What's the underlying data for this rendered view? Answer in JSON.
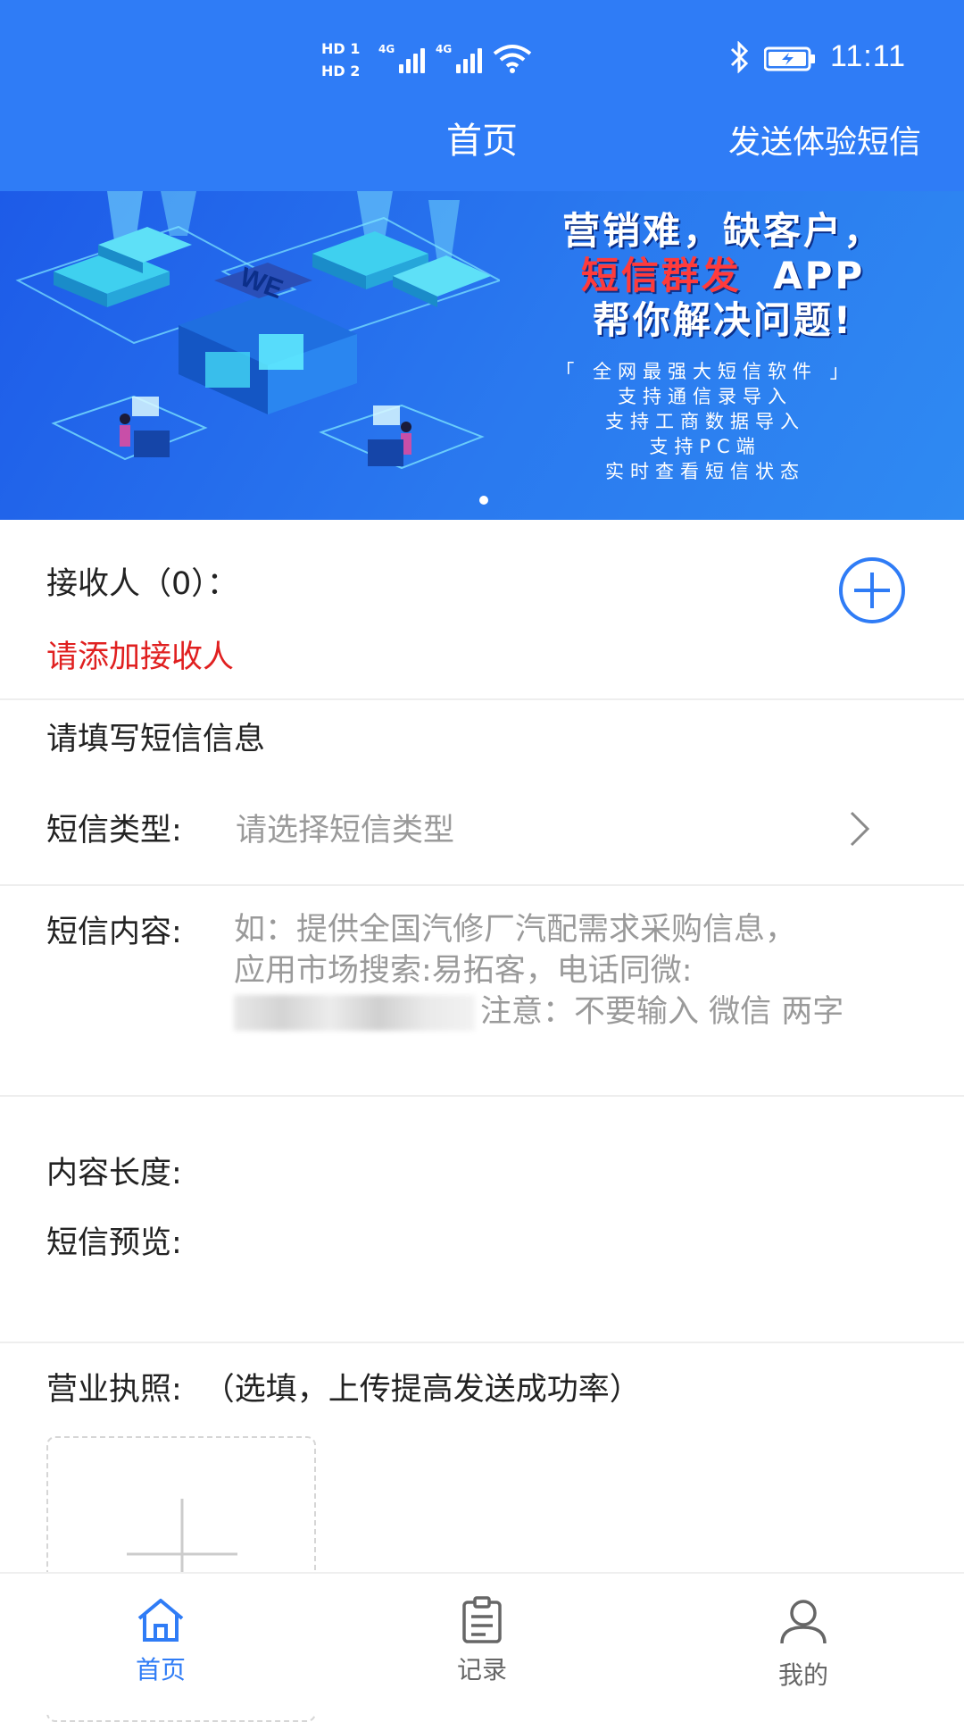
{
  "status_bar": {
    "hd1": "HD 1",
    "hd2": "HD 2",
    "network1": "4G",
    "network2": "4G",
    "time": "11:11"
  },
  "header": {
    "title": "首页",
    "action": "发送体验短信",
    "color": "#2f7cf6"
  },
  "banner": {
    "art_text": "WE",
    "headline_line1": "营销难，缺客户，",
    "headline_red": "短信群发",
    "headline_app": "APP",
    "headline_line3": "帮你解决问题!",
    "sub_lines": [
      "「 全网最强大短信软件 」",
      "支持通信录导入",
      "支持工商数据导入",
      "支持PC端",
      "实时查看短信状态"
    ]
  },
  "recipients": {
    "label": "接收人（0）：",
    "warning": "请添加接收人",
    "warning_color": "#e02020"
  },
  "sms_info": {
    "section_title": "请填写短信信息",
    "type_label": "短信类型:",
    "type_placeholder": "请选择短信类型",
    "content_label": "短信内容:",
    "content_placeholder_line1": "如：提供全国汽修厂汽配需求采购信息，",
    "content_placeholder_line2": "应用市场搜索:易拓客，电话同微:",
    "content_placeholder_line3": "注意：不要输入 微信 两字",
    "length_label": "内容长度:",
    "preview_label": "短信预览:"
  },
  "license": {
    "label": "营业执照:",
    "hint": "（选填，上传提高发送成功率）"
  },
  "tabbar": {
    "active_color": "#2f7cf6",
    "inactive_color": "#666666",
    "tabs": [
      {
        "label": "首页",
        "icon": "home-icon",
        "active": true
      },
      {
        "label": "记录",
        "icon": "clipboard-icon",
        "active": false
      },
      {
        "label": "我的",
        "icon": "user-icon",
        "active": false
      }
    ]
  }
}
